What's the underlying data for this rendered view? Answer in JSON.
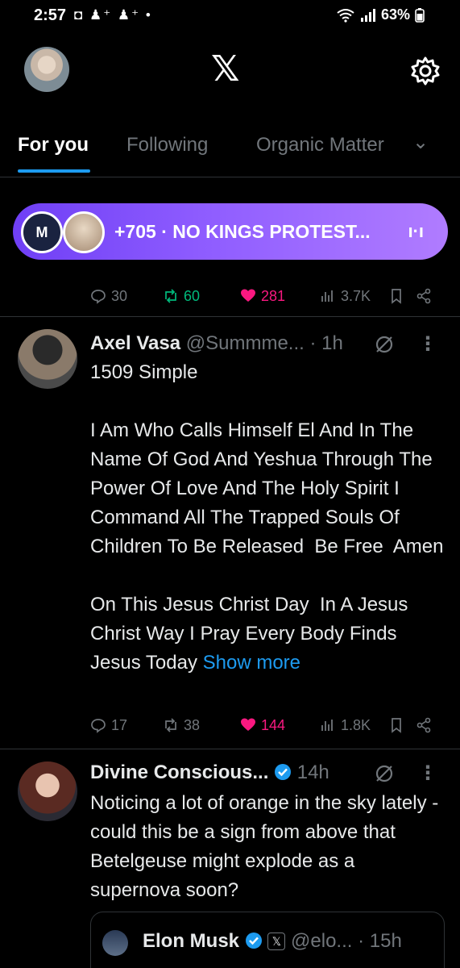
{
  "status_bar": {
    "time": "2:57",
    "left_icons": "◘ ♟⁺ ♟⁺ •",
    "battery": "63%"
  },
  "header": {
    "logo": "𝕏"
  },
  "tabs": [
    {
      "label": "For you",
      "active": true
    },
    {
      "label": "Following",
      "active": false
    },
    {
      "label": "Organic Matter",
      "active": false
    }
  ],
  "tab_dropdown": "⌄",
  "space_pill": {
    "avatar1_text": "M",
    "text": "+705 · NO KINGS PROTEST...",
    "icon": "ı·ı"
  },
  "post0_actions": {
    "replies": "30",
    "reposts": "60",
    "likes": "281",
    "views": "3.7K"
  },
  "tweet1": {
    "name": "Axel Vasa",
    "handle": "@Summme...",
    "time": "· 1h",
    "more": "⋮",
    "body": "1509 Simple\n\nI Am Who Calls Himself El And In The Name Of God And Yeshua Through The Power Of Love And The Holy Spirit I Command All The Trapped Souls Of Children To Be Released  Be Free  Amen\n\nOn This Jesus Christ Day  In A Jesus Christ Way I Pray Every Body Finds Jesus Today ",
    "show_more": "Show more",
    "replies": "17",
    "reposts": "38",
    "likes": "144",
    "views": "1.8K"
  },
  "tweet2": {
    "name": "Divine Conscious...",
    "time": "14h",
    "more": "⋮",
    "body": "Noticing a lot of orange in the sky lately - could this be a sign from above that Betelgeuse might explode as a supernova soon?",
    "quote": {
      "name": "Elon Musk",
      "x_badge": "𝕏",
      "handle": "@elo...",
      "time": "· 15h"
    }
  },
  "colors": {
    "accent": "#1d9bf0",
    "repost": "#00ba7c",
    "like": "#f91880",
    "pill_start": "#6f3ff5",
    "pill_end": "#b07cff"
  }
}
